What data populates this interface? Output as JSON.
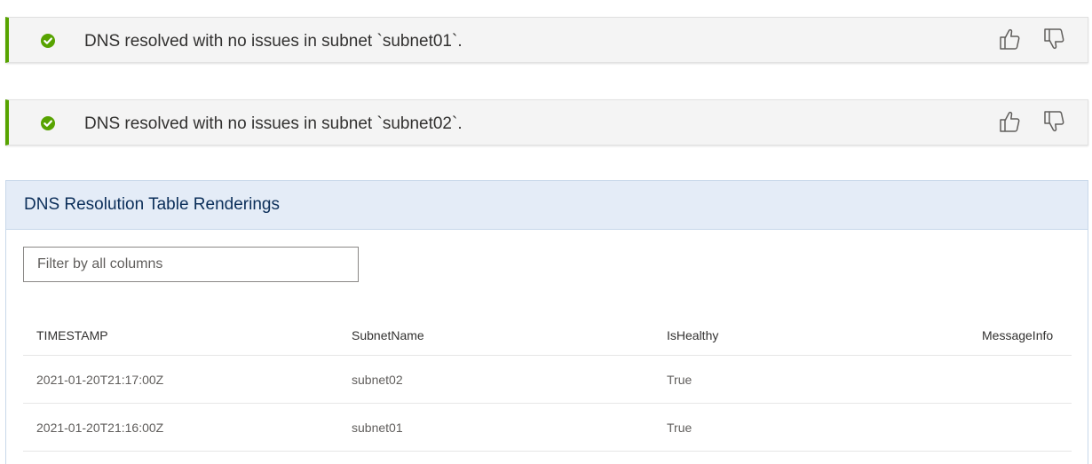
{
  "insights": [
    {
      "status_icon": "check-circle-icon",
      "status_color": "#57a300",
      "message": "DNS resolved with no issues in subnet `subnet01`.",
      "feedback": {
        "like_icon": "thumbs-up-icon",
        "dislike_icon": "thumbs-down-icon"
      }
    },
    {
      "status_icon": "check-circle-icon",
      "status_color": "#57a300",
      "message": "DNS resolved with no issues in subnet `subnet02`.",
      "feedback": {
        "like_icon": "thumbs-up-icon",
        "dislike_icon": "thumbs-down-icon"
      }
    }
  ],
  "table_panel": {
    "title": "DNS Resolution Table Renderings",
    "filter": {
      "value": "",
      "placeholder": "Filter by all columns"
    },
    "columns": [
      "TIMESTAMP",
      "SubnetName",
      "IsHealthy",
      "MessageInfo"
    ],
    "rows": [
      [
        "2021-01-20T21:17:00Z",
        "subnet02",
        "True",
        ""
      ],
      [
        "2021-01-20T21:16:00Z",
        "subnet01",
        "True",
        ""
      ]
    ]
  },
  "colors": {
    "success": "#57a300",
    "panel_header_bg": "#e4ecf7",
    "panel_title": "#0b2e59"
  }
}
